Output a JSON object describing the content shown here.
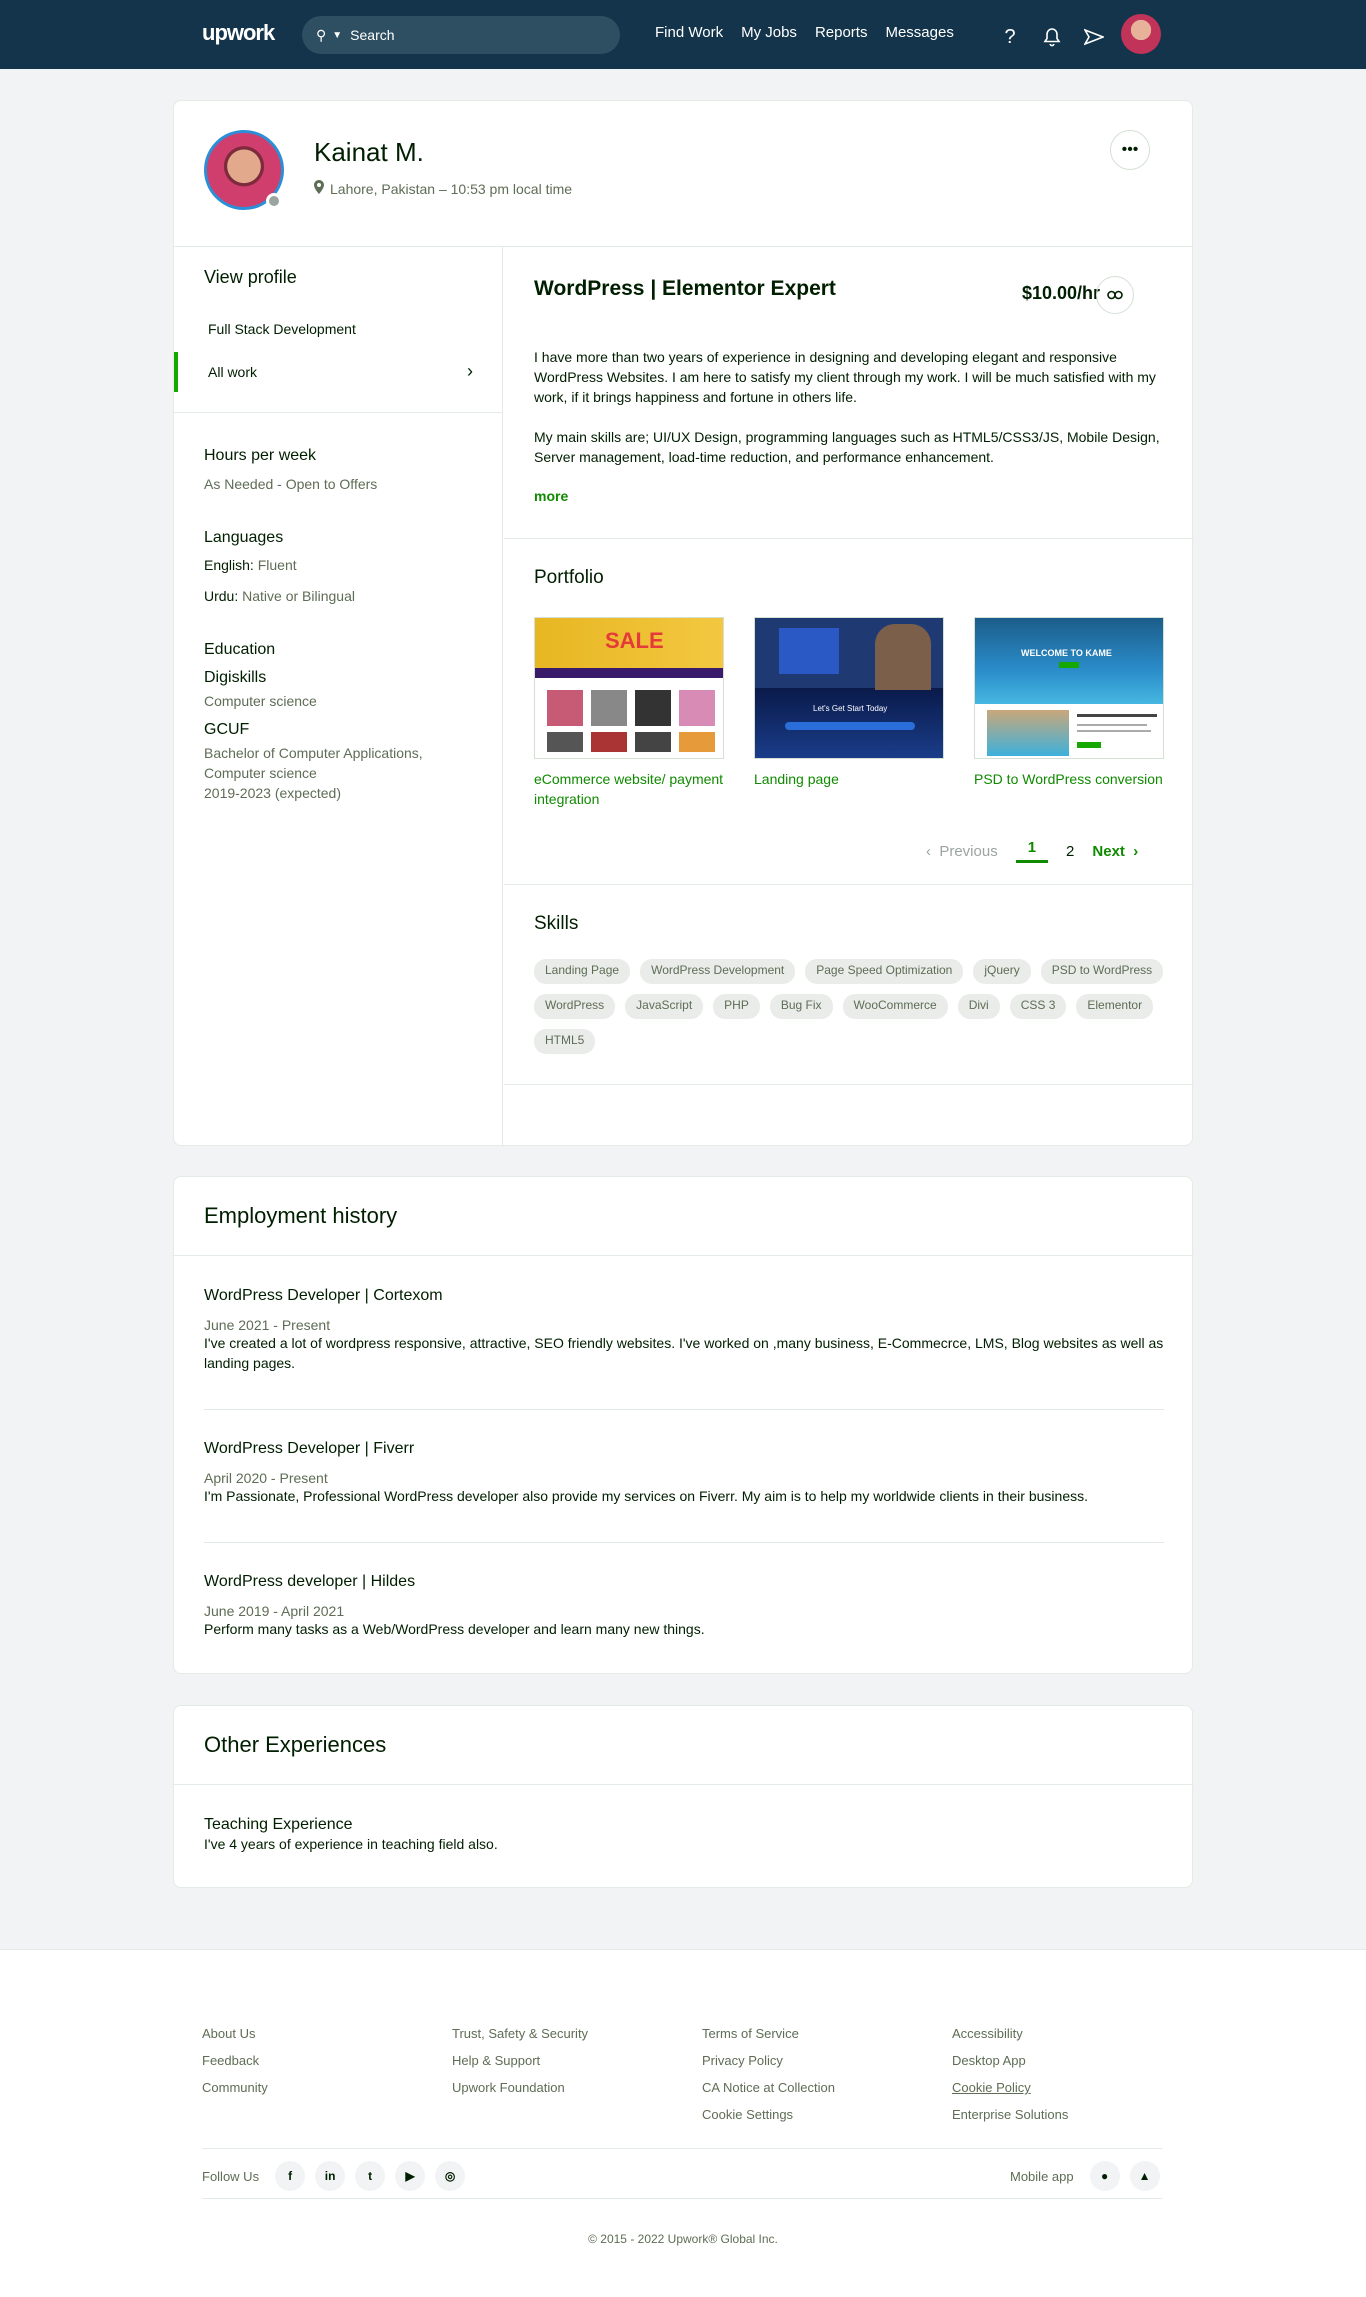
{
  "nav": {
    "logo": "upwork",
    "search_label": "Search",
    "links": [
      "Find Work",
      "My Jobs",
      "Reports",
      "Messages"
    ],
    "icons": [
      "help-icon",
      "bell-icon",
      "send-icon"
    ]
  },
  "profile": {
    "name": "Kainat M.",
    "location": "Lahore, Pakistan – 10:53 pm local time",
    "more_label": "•••"
  },
  "sidebar": {
    "title": "View profile",
    "items": [
      "Full Stack Development",
      "All work"
    ],
    "hours_title": "Hours per week",
    "hours_value": "As Needed - Open to Offers",
    "languages_title": "Languages",
    "languages": [
      {
        "name": "English:",
        "level": "Fluent"
      },
      {
        "name": "Urdu:",
        "level": "Native or Bilingual"
      }
    ],
    "education_title": "Education",
    "education": [
      {
        "school": "Digiskills",
        "detail": "Computer science"
      },
      {
        "school": "GCUF",
        "detail": "Bachelor of Computer Applications, Computer science",
        "years": "2019-2023 (expected)"
      }
    ]
  },
  "overview": {
    "title": "WordPress | Elementor Expert",
    "rate": "$10.00/hr",
    "p1": "I have more than two years of experience in designing and developing elegant and responsive WordPress Websites. I am here to satisfy my client through my work. I will be much satisfied with my work, if it brings happiness and fortune in others life.",
    "p2": "My main skills are; UI/UX Design, programming languages such as HTML5/CSS3/JS, Mobile Design, Server management, load-time reduction, and performance enhancement.",
    "more": "more"
  },
  "portfolio": {
    "title": "Portfolio",
    "items": [
      {
        "title": "eCommerce website/ payment integration"
      },
      {
        "title": "Landing page"
      },
      {
        "title": "PSD to WordPress conversion"
      }
    ],
    "thumb_texts": [
      "SALE",
      "Let's Get Start Today",
      "WELCOME TO KAME"
    ],
    "pager": {
      "prev": "Previous",
      "pages": [
        "1",
        "2"
      ],
      "next": "Next"
    }
  },
  "skills": {
    "title": "Skills",
    "items": [
      "Landing Page",
      "WordPress Development",
      "Page Speed Optimization",
      "jQuery",
      "PSD to WordPress",
      "WordPress",
      "JavaScript",
      "PHP",
      "Bug Fix",
      "WooCommerce",
      "Divi",
      "CSS 3",
      "Elementor",
      "HTML5"
    ]
  },
  "employment": {
    "title": "Employment history",
    "jobs": [
      {
        "title": "WordPress Developer | Cortexom",
        "dates": "June 2021 - Present",
        "desc": "I've created a lot of wordpress responsive, attractive, SEO friendly websites. I've worked on ,many business, E-Commecrce, LMS, Blog websites as well as landing pages."
      },
      {
        "title": "WordPress Developer | Fiverr",
        "dates": "April 2020 - Present",
        "desc": "I'm Passionate, Professional WordPress developer also provide my services on Fiverr. My aim is to help my worldwide clients in their business."
      },
      {
        "title": "WordPress developer | Hildes",
        "dates": "June 2019 - April 2021",
        "desc": "Perform many tasks as a Web/WordPress developer and learn many new things."
      }
    ]
  },
  "other": {
    "title": "Other Experiences",
    "item_title": "Teaching Experience",
    "item_desc": "I've 4 years of experience in teaching field also."
  },
  "footer": {
    "col1": [
      "About Us",
      "Feedback",
      "Community"
    ],
    "col2": [
      "Trust, Safety & Security",
      "Help & Support",
      "Upwork Foundation"
    ],
    "col3": [
      "Terms of Service",
      "Privacy Policy",
      "CA Notice at Collection",
      "Cookie Settings"
    ],
    "col4": [
      "Accessibility",
      "Desktop App",
      "Cookie Policy",
      "Enterprise Solutions"
    ],
    "follow_us": "Follow Us",
    "social": [
      "f",
      "in",
      "t",
      "▶",
      "◎"
    ],
    "mobile_app": "Mobile app",
    "copyright": "© 2015 - 2022 Upwork® Global Inc."
  },
  "colors": {
    "nav_bg": "#13344a",
    "accent": "#14a800",
    "link": "#108a00"
  }
}
